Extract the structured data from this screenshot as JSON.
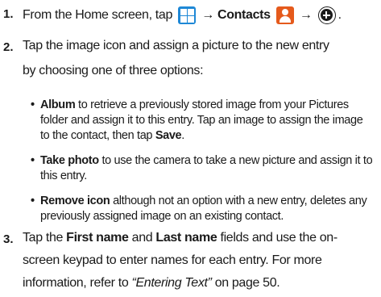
{
  "steps": [
    {
      "number": "1.",
      "lines": [
        {
          "pre": "From the Home screen, tap",
          "arrow1": "→",
          "contacts_label": "Contacts",
          "arrow2": "→",
          "end": "."
        }
      ]
    },
    {
      "number": "2.",
      "lines": [
        "Tap the image icon and assign a picture to the new entry",
        "by choosing one of three options:"
      ],
      "bullets": [
        {
          "term": "Album",
          "rows": [
            " to retrieve a previously stored image from your Pictures",
            "folder and assign it to this entry. Tap an image to assign the image",
            "to the contact, then tap "
          ],
          "save": "Save",
          "end": "."
        },
        {
          "term": "Take photo",
          "rows": [
            " to use the camera to take a new picture and assign it to",
            "this entry."
          ]
        },
        {
          "term": "Remove icon",
          "rows": [
            " although not an option with a new entry, deletes any",
            "previously assigned image on an existing contact."
          ]
        }
      ]
    },
    {
      "number": "3.",
      "line1_pre": "Tap the ",
      "first_name": "First name",
      "line1_mid": " and ",
      "last_name": "Last name",
      "line1_post": " fields and use the on-",
      "line2": "screen keypad to enter names for each entry. For more",
      "line3_pre": "information, refer to ",
      "link": "“Entering Text”",
      "line3_post": " on page 50."
    }
  ],
  "icons": {
    "home": "home-grid-icon",
    "contacts": "contacts-icon",
    "add": "add-contact-icon"
  }
}
